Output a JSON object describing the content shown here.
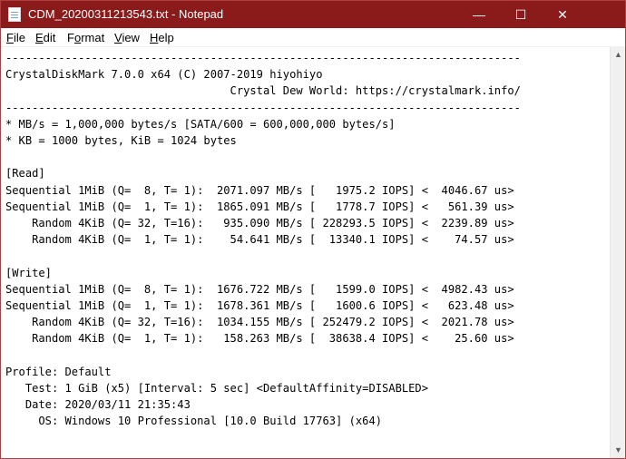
{
  "window": {
    "title": "CDM_20200311213543.txt - Notepad",
    "minimize_glyph": "—",
    "maximize_glyph": "☐",
    "close_glyph": "✕"
  },
  "menu": {
    "items": [
      {
        "accel": "F",
        "rest": "ile"
      },
      {
        "accel": "E",
        "rest": "dit"
      },
      {
        "accel": "o",
        "pre": "F",
        "rest": "rmat"
      },
      {
        "accel": "V",
        "rest": "iew"
      },
      {
        "accel": "H",
        "rest": "elp"
      }
    ]
  },
  "document": {
    "lines": [
      "------------------------------------------------------------------------------",
      "CrystalDiskMark 7.0.0 x64 (C) 2007-2019 hiyohiyo",
      "                                  Crystal Dew World: https://crystalmark.info/",
      "------------------------------------------------------------------------------",
      "* MB/s = 1,000,000 bytes/s [SATA/600 = 600,000,000 bytes/s]",
      "* KB = 1000 bytes, KiB = 1024 bytes",
      "",
      "[Read]",
      "Sequential 1MiB (Q=  8, T= 1):  2071.097 MB/s [   1975.2 IOPS] <  4046.67 us>",
      "Sequential 1MiB (Q=  1, T= 1):  1865.091 MB/s [   1778.7 IOPS] <   561.39 us>",
      "    Random 4KiB (Q= 32, T=16):   935.090 MB/s [ 228293.5 IOPS] <  2239.89 us>",
      "    Random 4KiB (Q=  1, T= 1):    54.641 MB/s [  13340.1 IOPS] <    74.57 us>",
      "",
      "[Write]",
      "Sequential 1MiB (Q=  8, T= 1):  1676.722 MB/s [   1599.0 IOPS] <  4982.43 us>",
      "Sequential 1MiB (Q=  1, T= 1):  1678.361 MB/s [   1600.6 IOPS] <   623.48 us>",
      "    Random 4KiB (Q= 32, T=16):  1034.155 MB/s [ 252479.2 IOPS] <  2021.78 us>",
      "    Random 4KiB (Q=  1, T= 1):   158.263 MB/s [  38638.4 IOPS] <    25.60 us>",
      "",
      "Profile: Default",
      "   Test: 1 GiB (x5) [Interval: 5 sec] <DefaultAffinity=DISABLED>",
      "   Date: 2020/03/11 21:35:43",
      "     OS: Windows 10 Professional [10.0 Build 17763] (x64)"
    ]
  },
  "scrollbar": {
    "up_glyph": "▲",
    "down_glyph": "▼"
  }
}
